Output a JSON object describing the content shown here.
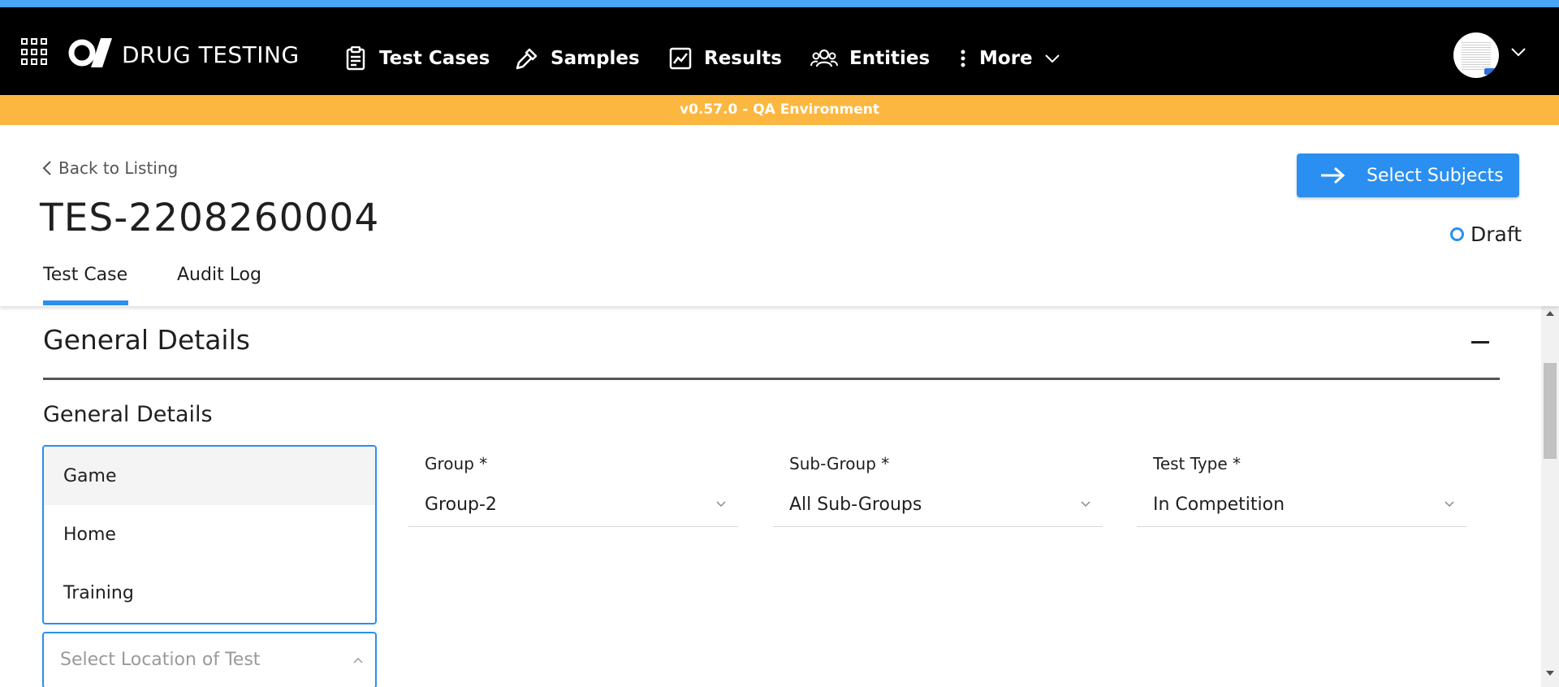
{
  "app": {
    "brand": "DRUG TESTING",
    "accent_color": "#2a8ff0",
    "env_color": "#fbb73f"
  },
  "nav": {
    "items": [
      {
        "label": "Test Cases",
        "icon": "clipboard-icon",
        "active": true
      },
      {
        "label": "Samples",
        "icon": "pipette-icon",
        "active": false
      },
      {
        "label": "Results",
        "icon": "chart-line-icon",
        "active": false
      },
      {
        "label": "Entities",
        "icon": "users-icon",
        "active": false
      },
      {
        "label": "More",
        "icon": "more-vertical-icon",
        "active": false
      }
    ]
  },
  "env_banner": "v0.57.0 - QA Environment",
  "header": {
    "back_label": "Back to Listing",
    "title": "TES-2208260004",
    "tabs": [
      {
        "label": "Test Case",
        "active": true
      },
      {
        "label": "Audit Log",
        "active": false
      }
    ],
    "primary_action": "Select Subjects",
    "status": "Draft"
  },
  "section": {
    "title": "General Details",
    "subtitle": "General Details"
  },
  "location_dropdown": {
    "options": [
      "Game",
      "Home",
      "Training"
    ],
    "hovered": "Game",
    "placeholder": "Select Location of Test"
  },
  "fields": [
    {
      "label": "Group *",
      "value": "Group-2"
    },
    {
      "label": "Sub-Group *",
      "value": "All Sub-Groups"
    },
    {
      "label": "Test Type *",
      "value": "In Competition"
    }
  ]
}
